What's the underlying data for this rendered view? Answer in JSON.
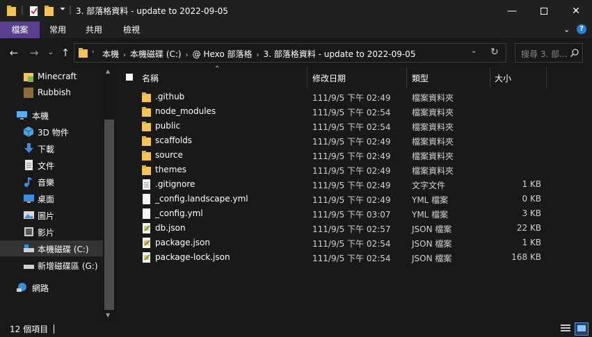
{
  "window": {
    "title": "3. 部落格資料 - update to 2022-09-05",
    "minimize_icon": "minimize-icon",
    "maximize_icon": "maximize-icon",
    "close_icon": "close-icon"
  },
  "ribbon": {
    "tabs": [
      {
        "label": "檔案",
        "active": true
      },
      {
        "label": "常用",
        "active": false
      },
      {
        "label": "共用",
        "active": false
      },
      {
        "label": "檢視",
        "active": false
      }
    ],
    "accent": "#5a3f8f"
  },
  "address": {
    "crumbs": [
      "本機",
      "本機磁碟 (C:)",
      "@ Hexo 部落格",
      "3. 部落格資料 - update to 2022-09-05"
    ],
    "search_placeholder": "搜尋 3. 部..."
  },
  "navpane": {
    "items": [
      {
        "label": "Minecraft",
        "icon": "folder-icon"
      },
      {
        "label": "Rubbish",
        "icon": "folder-icon"
      },
      {
        "label": "本機",
        "icon": "computer-icon"
      },
      {
        "label": "3D 物件",
        "icon": "cube-icon"
      },
      {
        "label": "下載",
        "icon": "download-icon"
      },
      {
        "label": "文件",
        "icon": "document-icon"
      },
      {
        "label": "音樂",
        "icon": "music-icon"
      },
      {
        "label": "桌面",
        "icon": "desktop-icon"
      },
      {
        "label": "圖片",
        "icon": "picture-icon"
      },
      {
        "label": "影片",
        "icon": "video-icon"
      },
      {
        "label": "本機磁碟 (C:)",
        "icon": "drive-icon"
      },
      {
        "label": "新增磁碟區 (G:)",
        "icon": "drive-icon"
      },
      {
        "label": "網路",
        "icon": "network-icon"
      }
    ]
  },
  "columns": {
    "name": "名稱",
    "date": "修改日期",
    "type": "類型",
    "size": "大小"
  },
  "files": [
    {
      "name": ".github",
      "date": "111/9/5 下午 02:49",
      "type": "檔案資料夾",
      "size": "",
      "kind": "folder"
    },
    {
      "name": "node_modules",
      "date": "111/9/5 下午 02:54",
      "type": "檔案資料夾",
      "size": "",
      "kind": "folder"
    },
    {
      "name": "public",
      "date": "111/9/5 下午 02:54",
      "type": "檔案資料夾",
      "size": "",
      "kind": "folder"
    },
    {
      "name": "scaffolds",
      "date": "111/9/5 下午 02:49",
      "type": "檔案資料夾",
      "size": "",
      "kind": "folder"
    },
    {
      "name": "source",
      "date": "111/9/5 下午 02:49",
      "type": "檔案資料夾",
      "size": "",
      "kind": "folder"
    },
    {
      "name": "themes",
      "date": "111/9/5 下午 02:49",
      "type": "檔案資料夾",
      "size": "",
      "kind": "folder"
    },
    {
      "name": ".gitignore",
      "date": "111/9/5 下午 02:49",
      "type": "文字文件",
      "size": "1 KB",
      "kind": "text"
    },
    {
      "name": "_config.landscape.yml",
      "date": "111/9/5 下午 02:49",
      "type": "YML 檔案",
      "size": "0 KB",
      "kind": "file"
    },
    {
      "name": "_config.yml",
      "date": "111/9/5 下午 03:07",
      "type": "YML 檔案",
      "size": "3 KB",
      "kind": "file"
    },
    {
      "name": "db.json",
      "date": "111/9/5 下午 02:57",
      "type": "JSON 檔案",
      "size": "22 KB",
      "kind": "json"
    },
    {
      "name": "package.json",
      "date": "111/9/5 下午 02:54",
      "type": "JSON 檔案",
      "size": "1 KB",
      "kind": "json"
    },
    {
      "name": "package-lock.json",
      "date": "111/9/5 下午 02:54",
      "type": "JSON 檔案",
      "size": "168 KB",
      "kind": "json"
    }
  ],
  "status": {
    "count": "12 個項目"
  }
}
